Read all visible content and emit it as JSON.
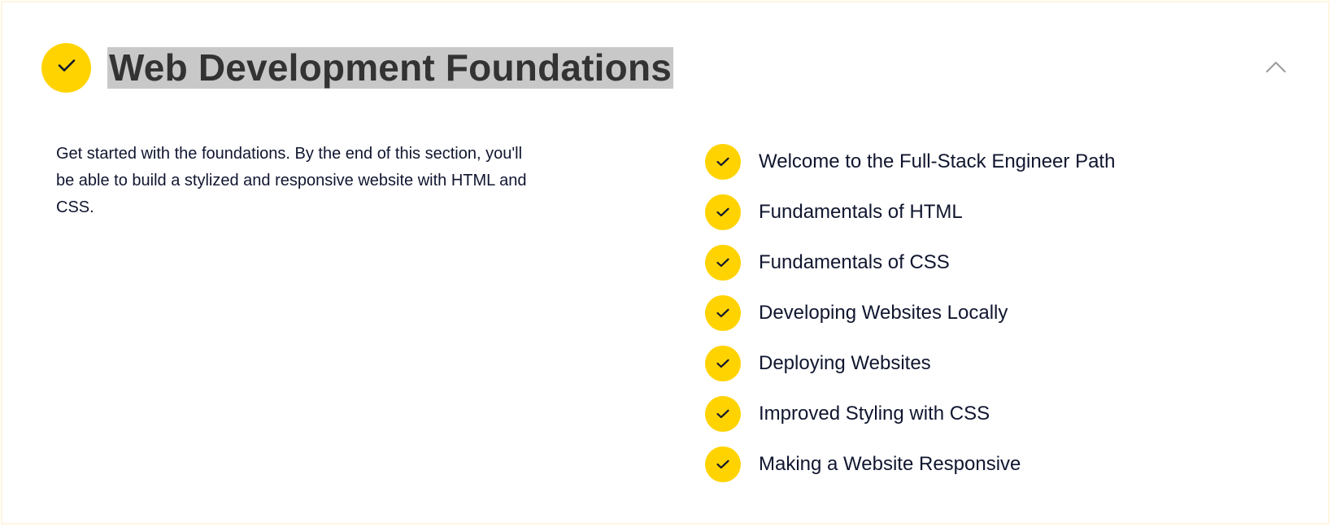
{
  "section": {
    "title": "Web Development Foundations",
    "description": "Get started with the foundations. By the end of this section, you'll be able to build a stylized and responsive website with HTML and CSS.",
    "status_icon": "checkmark-icon",
    "toggle_icon": "chevron-up-icon"
  },
  "modules": [
    {
      "label": "Welcome to the Full-Stack Engineer Path",
      "icon": "checkmark-icon"
    },
    {
      "label": "Fundamentals of HTML",
      "icon": "checkmark-icon"
    },
    {
      "label": "Fundamentals of CSS",
      "icon": "checkmark-icon"
    },
    {
      "label": "Developing Websites Locally",
      "icon": "checkmark-icon"
    },
    {
      "label": "Deploying Websites",
      "icon": "checkmark-icon"
    },
    {
      "label": "Improved Styling with CSS",
      "icon": "checkmark-icon"
    },
    {
      "label": "Making a Website Responsive",
      "icon": "checkmark-icon"
    }
  ],
  "colors": {
    "accent": "#ffd300",
    "text": "#10162f",
    "title": "#333333",
    "title_highlight": "#c8c8c8",
    "border": "#fff6e0"
  }
}
